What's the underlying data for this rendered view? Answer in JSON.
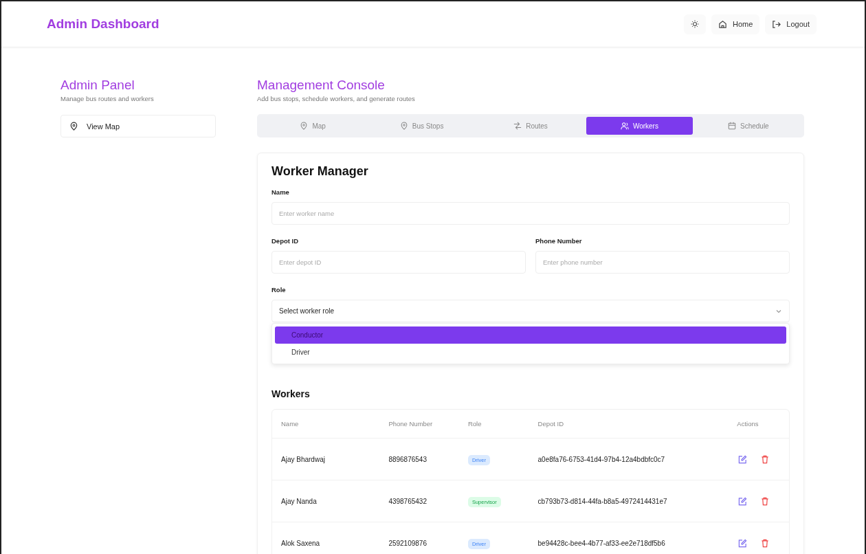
{
  "header": {
    "title": "Admin Dashboard",
    "buttons": [
      {
        "kind": "theme"
      },
      {
        "kind": "home",
        "label": "Home"
      },
      {
        "kind": "logout",
        "label": "Logout"
      }
    ]
  },
  "sidebar": {
    "title": "Admin Panel",
    "subtitle": "Manage bus routes and workers",
    "items": [
      {
        "label": "View Map",
        "selected": false
      }
    ]
  },
  "console": {
    "title": "Management Console",
    "subtitle": "Add bus stops, schedule workers, and generate routes"
  },
  "tabs": [
    {
      "label": "Map",
      "selected": false
    },
    {
      "label": "Bus Stops",
      "selected": false
    },
    {
      "label": "Routes",
      "selected": false
    },
    {
      "label": "Workers",
      "selected": true
    },
    {
      "label": "Schedule",
      "selected": false
    }
  ],
  "form": {
    "title": "Worker Manager",
    "name": {
      "label": "Name",
      "placeholder": "Enter worker name"
    },
    "depot": {
      "label": "Depot ID",
      "placeholder": "Enter depot ID"
    },
    "phone": {
      "label": "Phone Number",
      "placeholder": "Enter phone number"
    },
    "role": {
      "label": "Role",
      "value": "Select worker role",
      "options": [
        {
          "label": "Conductor",
          "selected": true
        },
        {
          "label": "Driver",
          "selected": false
        }
      ]
    }
  },
  "workers": {
    "title": "Workers",
    "columns": [
      "Name",
      "Phone Number",
      "Role",
      "Depot ID",
      "Actions"
    ],
    "rows": [
      {
        "name": "Ajay Bhardwaj",
        "phone": "8896876543",
        "role": "Driver",
        "color": "#dbeafe",
        "depot": "a0e8fa76-6753-41d4-97b4-12a4bdbfc0c7"
      },
      {
        "name": "Ajay Nanda",
        "phone": "4398765432",
        "role": "Supervisor",
        "color": "#dcfce7",
        "depot": "cb793b73-d814-44fa-b8a5-4972414431e7"
      },
      {
        "name": "Alok Saxena",
        "phone": "2592109876",
        "role": "Driver",
        "color": "#dbeafe",
        "depot": "be94428c-bee4-4b77-af33-ee2e718df5b6"
      }
    ]
  }
}
